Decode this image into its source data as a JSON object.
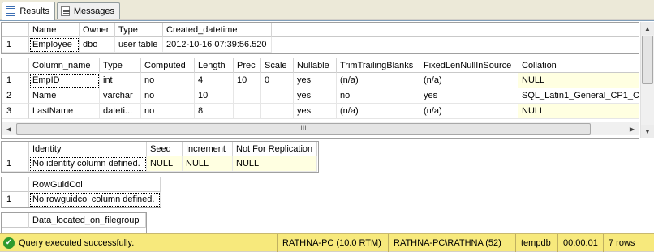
{
  "tabs": [
    {
      "label": "Results",
      "icon": "grid-icon"
    },
    {
      "label": "Messages",
      "icon": "messages-icon"
    }
  ],
  "grid1": {
    "headers": [
      "Name",
      "Owner",
      "Type",
      "Created_datetime"
    ],
    "rows": [
      [
        "1",
        "Employee",
        "dbo",
        "user table",
        "2012-10-16 07:39:56.520"
      ]
    ]
  },
  "grid2": {
    "headers": [
      "Column_name",
      "Type",
      "Computed",
      "Length",
      "Prec",
      "Scale",
      "Nullable",
      "TrimTrailingBlanks",
      "FixedLenNullInSource",
      "Collation"
    ],
    "rows": [
      [
        "1",
        "EmpID",
        "int",
        "no",
        "4",
        "10",
        "0",
        "yes",
        "(n/a)",
        "(n/a)",
        "NULL"
      ],
      [
        "2",
        "Name",
        "varchar",
        "no",
        "10",
        "",
        "",
        "yes",
        "no",
        "yes",
        "SQL_Latin1_General_CP1_C"
      ],
      [
        "3",
        "LastName",
        "dateti...",
        "no",
        "8",
        "",
        "",
        "yes",
        "(n/a)",
        "(n/a)",
        "NULL"
      ]
    ],
    "scroll_glyph": "III"
  },
  "grid3": {
    "headers": [
      "Identity",
      "Seed",
      "Increment",
      "Not For Replication"
    ],
    "rows": [
      [
        "1",
        "No identity column defined.",
        "NULL",
        "NULL",
        "NULL"
      ]
    ]
  },
  "grid4": {
    "headers": [
      "RowGuidCol"
    ],
    "rows": [
      [
        "1",
        "No rowguidcol column defined."
      ]
    ]
  },
  "grid5": {
    "headers": [
      "Data_located_on_filegroup"
    ]
  },
  "status": {
    "message": "Query executed successfully.",
    "server": "RATHNA-PC (10.0 RTM)",
    "user": "RATHNA-PC\\RATHNA (52)",
    "database": "tempdb",
    "elapsed": "00:00:01",
    "rows": "7 rows"
  },
  "colors": {
    "status_bar": "#f7e97c",
    "null_cell": "#ffffe1",
    "ok": "#2e9a2e"
  }
}
